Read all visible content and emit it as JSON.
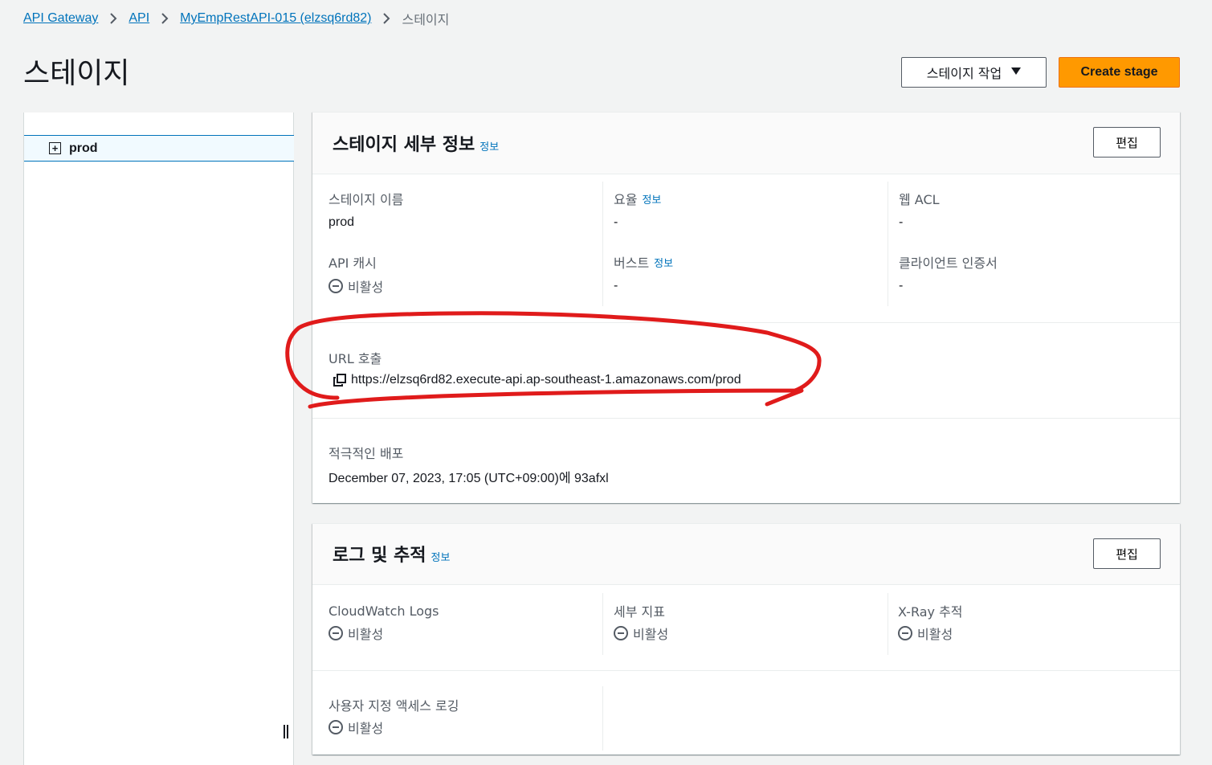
{
  "breadcrumb": {
    "items": [
      "API Gateway",
      "API",
      "MyEmpRestAPI-015 (elzsq6rd82)"
    ],
    "current": "스테이지"
  },
  "page": {
    "title": "스테이지",
    "actions_label": "스테이지 작업",
    "create_label": "Create stage"
  },
  "tree": {
    "toggle": "+",
    "items": [
      {
        "label": "prod"
      }
    ]
  },
  "stage_details": {
    "title": "스테이지 세부 정보",
    "info": "정보",
    "edit": "편집",
    "fields": {
      "stage_name": {
        "label": "스테이지 이름",
        "value": "prod"
      },
      "rate": {
        "label": "요율",
        "info": "정보",
        "value": "-"
      },
      "web_acl": {
        "label": "웹 ACL",
        "value": "-"
      },
      "api_cache": {
        "label": "API 캐시",
        "value": "비활성"
      },
      "burst": {
        "label": "버스트",
        "info": "정보",
        "value": "-"
      },
      "client_cert": {
        "label": "클라이언트 인증서",
        "value": "-"
      },
      "invoke_url": {
        "label": "URL 호출",
        "value": "https://elzsq6rd82.execute-api.ap-southeast-1.amazonaws.com/prod"
      },
      "active_deployment": {
        "label": "적극적인 배포",
        "value": "December 07, 2023, 17:05 (UTC+09:00)에 93afxl"
      }
    }
  },
  "logs": {
    "title": "로그 및 추적",
    "info": "정보",
    "edit": "편집",
    "fields": {
      "cloudwatch": {
        "label": "CloudWatch Logs",
        "value": "비활성"
      },
      "metrics": {
        "label": "세부 지표",
        "value": "비활성"
      },
      "xray": {
        "label": "X-Ray 추적",
        "value": "비활성"
      },
      "custom_access": {
        "label": "사용자 지정 액세스 로깅",
        "value": "비활성"
      }
    }
  },
  "colors": {
    "link": "#0073bb",
    "primary_button": "#ff9900",
    "annotation": "#e01b1b"
  }
}
